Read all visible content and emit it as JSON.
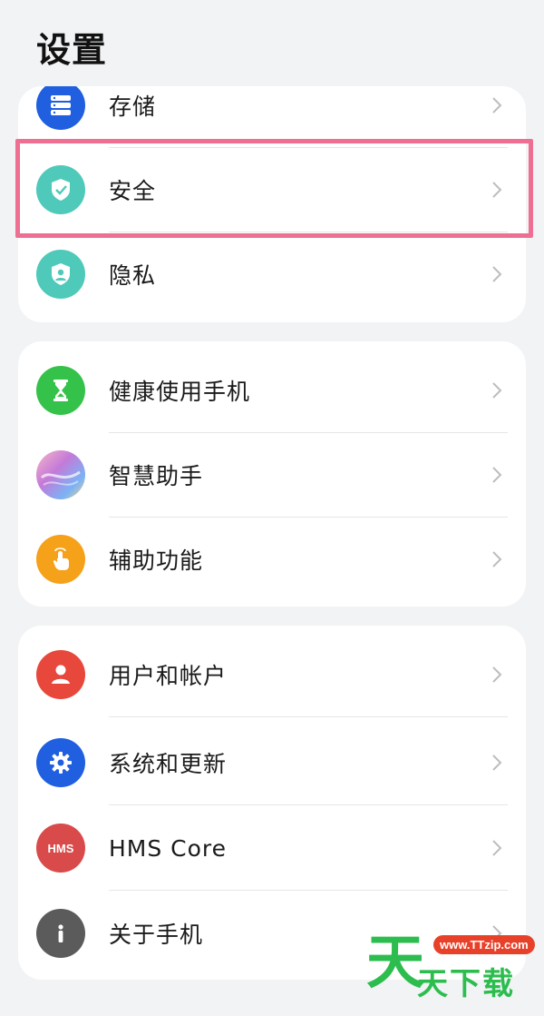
{
  "header": {
    "title": "设置"
  },
  "groups": [
    {
      "items": [
        {
          "label": "存储",
          "icon": "storage-icon",
          "color": "#1f5fe0"
        },
        {
          "label": "安全",
          "icon": "shield-check-icon",
          "color": "#4fc9b9"
        },
        {
          "label": "隐私",
          "icon": "privacy-shield-icon",
          "color": "#4fc9b9"
        }
      ]
    },
    {
      "items": [
        {
          "label": "健康使用手机",
          "icon": "hourglass-icon",
          "color": "#35c24a"
        },
        {
          "label": "智慧助手",
          "icon": "assistant-orb-icon",
          "color": "#c47ad8"
        },
        {
          "label": "辅助功能",
          "icon": "touch-hand-icon",
          "color": "#f5a11a"
        }
      ]
    },
    {
      "items": [
        {
          "label": "用户和帐户",
          "icon": "user-icon",
          "color": "#e8473c"
        },
        {
          "label": "系统和更新",
          "icon": "gear-icon",
          "color": "#1f5fe0"
        },
        {
          "label": "HMS Core",
          "icon": "hms-icon",
          "color": "#d94a4a",
          "icon_text": "HMS"
        },
        {
          "label": "关于手机",
          "icon": "info-icon",
          "color": "#5b5b5b"
        }
      ]
    }
  ],
  "watermark": {
    "url": "www.TTzip.com",
    "big": "天",
    "small": "天下载"
  }
}
